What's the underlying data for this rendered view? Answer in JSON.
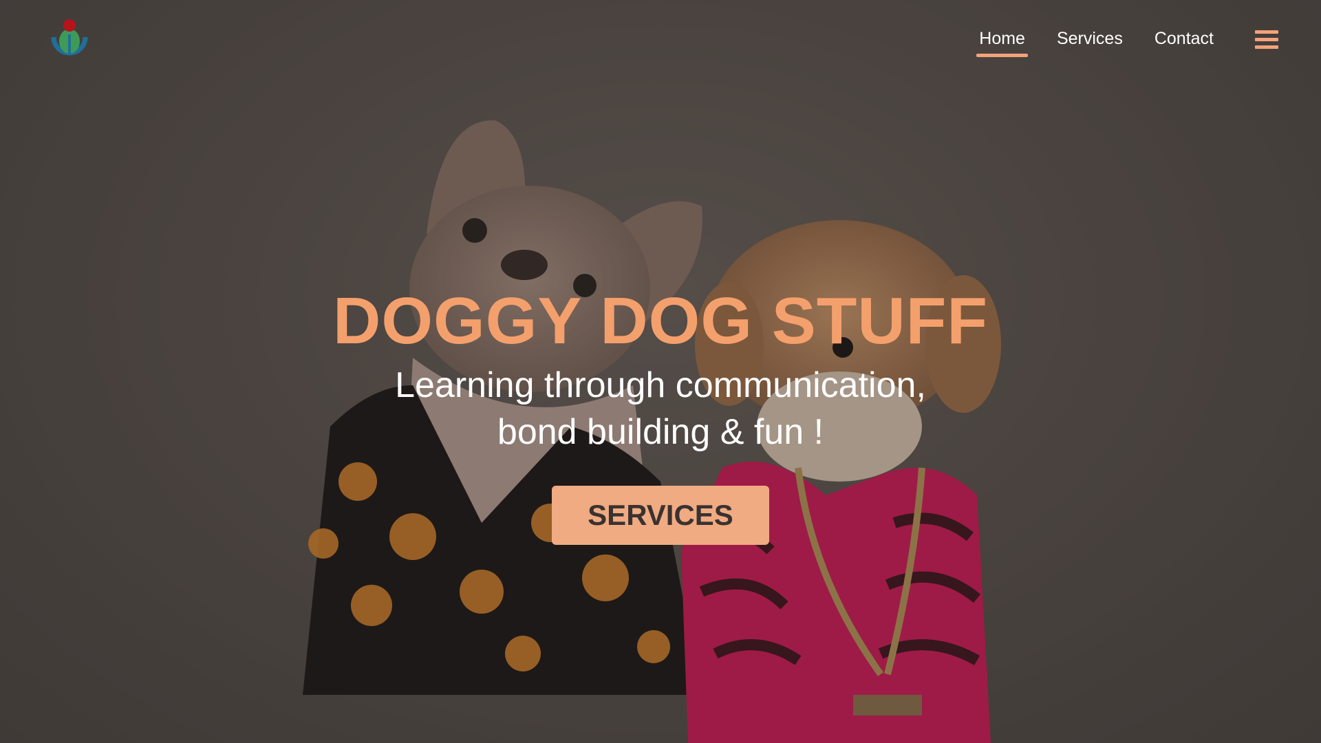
{
  "header": {
    "logo_icon": "wikimedia-logo-icon",
    "nav": [
      {
        "label": "Home",
        "active": true
      },
      {
        "label": "Services",
        "active": false
      },
      {
        "label": "Contact",
        "active": false
      }
    ],
    "menu_icon": "hamburger-menu-icon"
  },
  "hero": {
    "title": "DOGGY DOG STUFF",
    "subtitle_line1": "Learning through communication,",
    "subtitle_line2": "bond building & fun !",
    "button_label": "SERVICES",
    "background_image": "two-dogs-in-jackets-photo"
  },
  "colors": {
    "accent": "#f4a06d",
    "button_bg": "#f0ab82",
    "button_text": "#3a3230",
    "nav_text": "#ffffff"
  }
}
